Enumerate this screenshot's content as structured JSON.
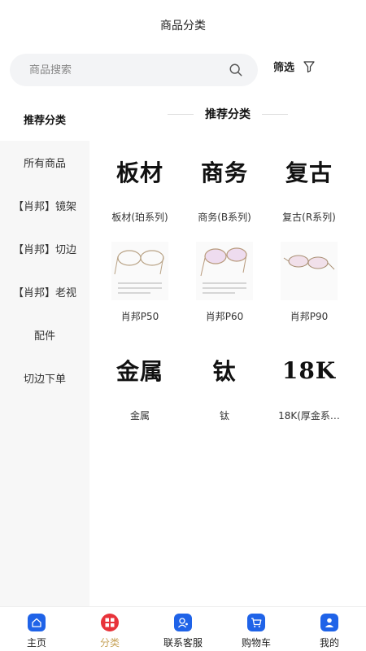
{
  "header": {
    "title": "商品分类"
  },
  "search": {
    "placeholder": "商品搜索",
    "filter_label": "筛选"
  },
  "sidebar": {
    "items": [
      {
        "label": "推荐分类",
        "active": true
      },
      {
        "label": "所有商品"
      },
      {
        "label": "【肖邦】镜架"
      },
      {
        "label": "【肖邦】切边"
      },
      {
        "label": "【肖邦】老视"
      },
      {
        "label": "配件"
      },
      {
        "label": "切边下单"
      }
    ]
  },
  "main": {
    "section_title": "推荐分类",
    "categories": [
      {
        "thumb_text": "板材",
        "label": "板材(珀系列)"
      },
      {
        "thumb_text": "商务",
        "label": "商务(B系列)"
      },
      {
        "thumb_text": "复古",
        "label": "复古(R系列)"
      },
      {
        "thumb_icon": "glasses-photo",
        "label": "肖邦P50"
      },
      {
        "thumb_icon": "glasses-photo",
        "label": "肖邦P60"
      },
      {
        "thumb_icon": "glasses-photo",
        "label": "肖邦P90"
      },
      {
        "thumb_text": "金属",
        "label": "金属"
      },
      {
        "thumb_text": "钛",
        "label": "钛"
      },
      {
        "thumb_text": "18K",
        "label": "18K(厚金系…"
      }
    ]
  },
  "tabbar": {
    "items": [
      {
        "label": "主页",
        "icon": "home-icon"
      },
      {
        "label": "分类",
        "icon": "category-icon",
        "selected": true
      },
      {
        "label": "联系客服",
        "icon": "service-icon"
      },
      {
        "label": "购物车",
        "icon": "cart-icon"
      },
      {
        "label": "我的",
        "icon": "user-icon"
      }
    ]
  },
  "colors": {
    "accent_blue": "#1f63e8",
    "accent_red": "#e8333a",
    "selected_tab_text": "#c7a35a"
  }
}
